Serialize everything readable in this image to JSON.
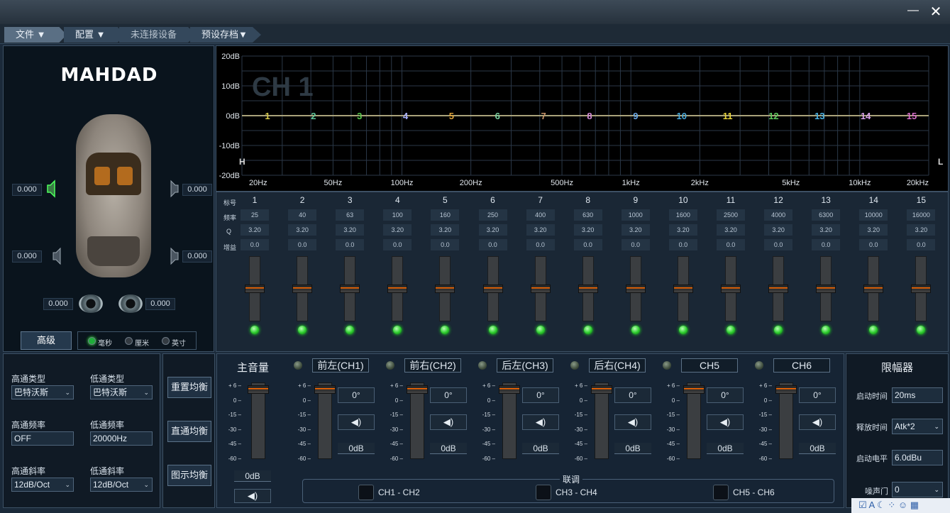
{
  "window": {
    "minimize": "—",
    "close": "✕"
  },
  "menu": {
    "items": [
      "文件 ▼",
      "配置 ▼",
      "未连接设备",
      "预设存档▼"
    ]
  },
  "left": {
    "logo": "MAHDAD",
    "delays": {
      "fl": "0.000",
      "fr": "0.000",
      "rl": "0.000",
      "rr": "0.000",
      "sub_l": "0.000",
      "sub_r": "0.000"
    },
    "advanced": "高级",
    "units": [
      "毫秒",
      "厘米",
      "英寸"
    ],
    "unit_selected": "毫秒"
  },
  "graph": {
    "channel": "CH 1",
    "y_ticks": [
      "20dB",
      "10dB",
      "0dB",
      "-10dB",
      "-20dB"
    ],
    "x_ticks": [
      "20Hz",
      "50Hz",
      "100Hz",
      "200Hz",
      "500Hz",
      "1kHz",
      "2kHz",
      "5kHz",
      "10kHz",
      "20kHz"
    ],
    "h_label": "H",
    "l_label": "L",
    "markers": [
      "1",
      "2",
      "3",
      "4",
      "5",
      "6",
      "7",
      "8",
      "9",
      "10",
      "11",
      "12",
      "13",
      "14",
      "15"
    ],
    "marker_colors": [
      "#d6c84b",
      "#5fc79a",
      "#56c34b",
      "#a9b2ff",
      "#e0a53c",
      "#7ad0a0",
      "#c8956a",
      "#d48cd8",
      "#6aa8e8",
      "#4aa8d8",
      "#e6d23a",
      "#5cc85c",
      "#4ab0e0",
      "#d8a0e8",
      "#d870c8"
    ]
  },
  "bands": {
    "row_labels": {
      "num": "标号",
      "freq": "频率",
      "q": "Q",
      "gain": "增益"
    },
    "nums": [
      "1",
      "2",
      "3",
      "4",
      "5",
      "6",
      "7",
      "8",
      "9",
      "10",
      "11",
      "12",
      "13",
      "14",
      "15"
    ],
    "freqs": [
      "25",
      "40",
      "63",
      "100",
      "160",
      "250",
      "400",
      "630",
      "1000",
      "1600",
      "2500",
      "4000",
      "6300",
      "10000",
      "16000"
    ],
    "qs": [
      "3.20",
      "3.20",
      "3.20",
      "3.20",
      "3.20",
      "3.20",
      "3.20",
      "3.20",
      "3.20",
      "3.20",
      "3.20",
      "3.20",
      "3.20",
      "3.20",
      "3.20"
    ],
    "gains": [
      "0.0",
      "0.0",
      "0.0",
      "0.0",
      "0.0",
      "0.0",
      "0.0",
      "0.0",
      "0.0",
      "0.0",
      "0.0",
      "0.0",
      "0.0",
      "0.0",
      "0.0"
    ]
  },
  "crossover": {
    "hp_type_label": "高通类型",
    "lp_type_label": "低通类型",
    "hp_type": "巴特沃斯",
    "lp_type": "巴特沃斯",
    "hp_freq_label": "高通频率",
    "lp_freq_label": "低通频率",
    "hp_freq": "OFF",
    "lp_freq": "20000Hz",
    "hp_slope_label": "高通斜率",
    "lp_slope_label": "低通斜率",
    "hp_slope": "12dB/Oct",
    "lp_slope": "12dB/Oct"
  },
  "eq_buttons": {
    "reset": "重置均衡",
    "bypass": "直通均衡",
    "graphic": "图示均衡"
  },
  "mixer": {
    "master_label": "主音量",
    "master_gain": "0dB",
    "scale": [
      "+ 6",
      "0",
      "-15",
      "-30",
      "-45",
      "-60"
    ],
    "channels": [
      {
        "name": "前左(CH1)",
        "phase": "0°",
        "gain": "0dB"
      },
      {
        "name": "前右(CH2)",
        "phase": "0°",
        "gain": "0dB"
      },
      {
        "name": "后左(CH3)",
        "phase": "0°",
        "gain": "0dB"
      },
      {
        "name": "后右(CH4)",
        "phase": "0°",
        "gain": "0dB"
      },
      {
        "name": "CH5",
        "phase": "0°",
        "gain": "0dB"
      },
      {
        "name": "CH6",
        "phase": "0°",
        "gain": "0dB"
      }
    ],
    "mute_icon": "◀)",
    "link_label": "联调",
    "links": [
      "CH1 - CH2",
      "CH3 - CH4",
      "CH5 - CH6"
    ]
  },
  "limiter": {
    "title": "限幅器",
    "attack_label": "启动时间",
    "attack": "20ms",
    "release_label": "释放时间",
    "release": "Atk*2",
    "threshold_label": "启动电平",
    "threshold": "6.0dBu",
    "noise_gate_label": "噪声门",
    "noise_gate": "0"
  },
  "taskbar": {
    "icons": "☑ A ☾ ⁘ ☺ ▦"
  }
}
